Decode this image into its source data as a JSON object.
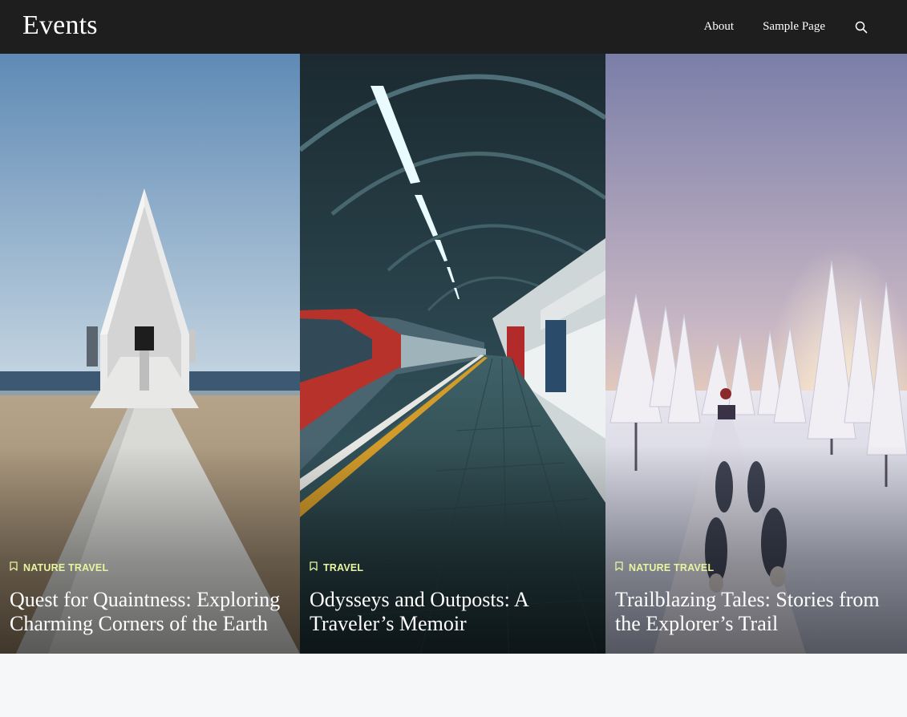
{
  "site": {
    "title": "Events"
  },
  "nav": {
    "items": [
      "About",
      "Sample Page"
    ],
    "search_icon": "search-icon"
  },
  "posts": [
    {
      "category": "NATURE TRAVEL",
      "title": "Quest for Quaintness: Exploring Charming Corners of the Earth"
    },
    {
      "category": "TRAVEL",
      "title": "Odysseys and Outposts: A Traveler’s Memoir"
    },
    {
      "category": "NATURE TRAVEL",
      "title": "Trailblazing Tales: Stories from the Explorer’s Trail"
    }
  ],
  "colors": {
    "header_bg": "#1e1e1e",
    "category_accent": "#e8f5a0",
    "page_bg": "#f6f7f9"
  }
}
